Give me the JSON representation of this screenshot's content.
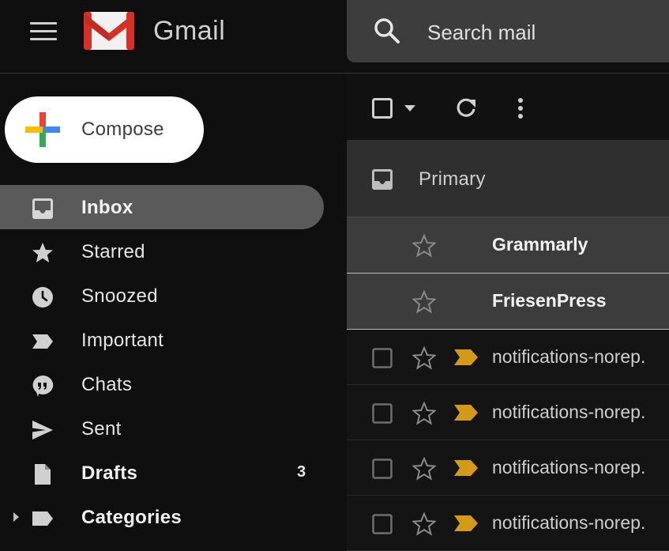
{
  "app": {
    "brand": "Gmail"
  },
  "search": {
    "placeholder": "Search mail"
  },
  "compose": {
    "label": "Compose"
  },
  "sidebar": {
    "items": [
      {
        "label": "Inbox",
        "icon": "inbox-icon",
        "active": true,
        "bold": true
      },
      {
        "label": "Starred",
        "icon": "star-icon"
      },
      {
        "label": "Snoozed",
        "icon": "clock-icon"
      },
      {
        "label": "Important",
        "icon": "important-icon"
      },
      {
        "label": "Chats",
        "icon": "chat-icon"
      },
      {
        "label": "Sent",
        "icon": "send-icon"
      },
      {
        "label": "Drafts",
        "icon": "draft-icon",
        "bold": true,
        "count": "3"
      },
      {
        "label": "Categories",
        "icon": "label-icon",
        "bold": true
      }
    ]
  },
  "tabs": {
    "primary": "Primary"
  },
  "messages": [
    {
      "sender": "Grammarly",
      "unread": true
    },
    {
      "sender": "FriesenPress",
      "unread": true
    },
    {
      "sender": "notifications-norep.",
      "unread": false,
      "important": true
    },
    {
      "sender": "notifications-norep.",
      "unread": false,
      "important": true
    },
    {
      "sender": "notifications-norep.",
      "unread": false,
      "important": true
    },
    {
      "sender": "notifications-norep.",
      "unread": false,
      "important": true
    }
  ],
  "colors": {
    "background": "#0f0f0f",
    "active_nav": "#5a5a5a",
    "unread_row": "#3c3c3c",
    "important_marker": "#d29a16",
    "logo_red": "#d93025"
  }
}
